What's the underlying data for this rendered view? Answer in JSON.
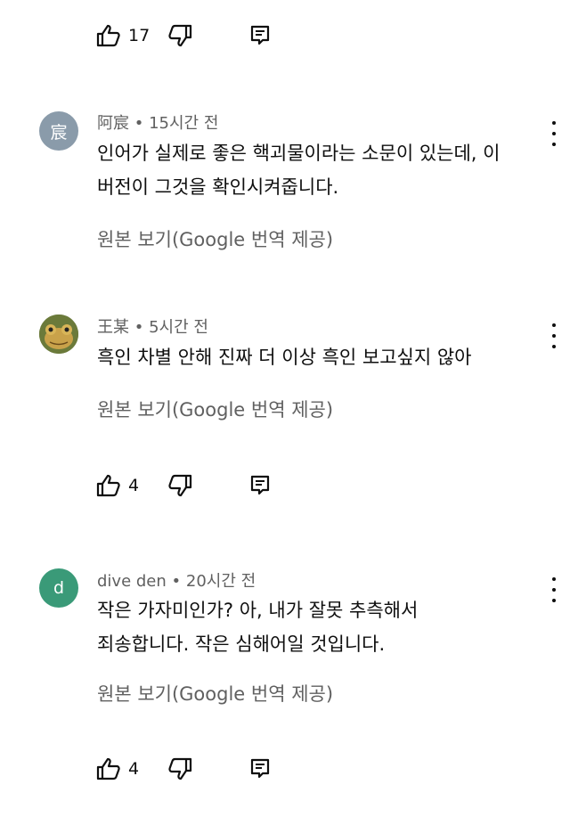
{
  "top_actions": {
    "like_count": "17"
  },
  "comments": [
    {
      "avatar_text": "宸",
      "avatar_color": "#8a9baa",
      "author": "阿宸",
      "time": "• 15시간 전",
      "text": "인어가 실제로 좋은 핵괴물이라는 소문이 있는데, 이\n버전이 그것을 확인시켜줍니다.",
      "translate_label": "원본 보기(Google 번역 제공)"
    },
    {
      "avatar_text": "",
      "avatar_color": "#7a8a3a",
      "author": "王某",
      "time": "• 5시간 전",
      "text": "흑인 차별 안해 진짜 더 이상 흑인 보고싶지 않아",
      "translate_label": "원본 보기(Google 번역 제공)",
      "like_count": "4"
    },
    {
      "avatar_text": "d",
      "avatar_color": "#3a9a78",
      "author": "dive den",
      "time": "• 20시간 전",
      "text": "작은 가자미인가? 아, 내가 잘못 추측해서\n죄송합니다. 작은 심해어일 것입니다.",
      "translate_label": "원본 보기(Google 번역 제공)",
      "like_count": "4"
    }
  ]
}
